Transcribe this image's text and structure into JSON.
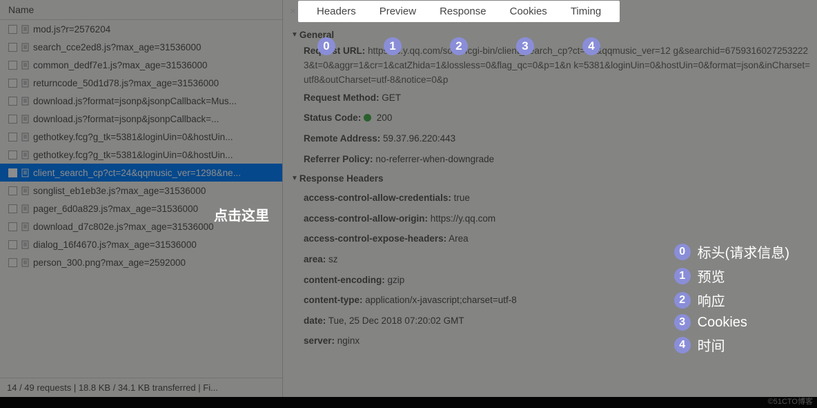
{
  "columns": {
    "name": "Name"
  },
  "requests": [
    {
      "name": "mod.js?r=2576204",
      "selected": false
    },
    {
      "name": "search_cce2ed8.js?max_age=31536000",
      "selected": false
    },
    {
      "name": "common_dedf7e1.js?max_age=31536000",
      "selected": false
    },
    {
      "name": "returncode_50d1d78.js?max_age=31536000",
      "selected": false
    },
    {
      "name": "download.js?format=jsonp&jsonpCallback=Mus...",
      "selected": false
    },
    {
      "name": "download.js?format=jsonp&jsonpCallback=...",
      "selected": false
    },
    {
      "name": "gethotkey.fcg?g_tk=5381&loginUin=0&hostUin...",
      "selected": false
    },
    {
      "name": "gethotkey.fcg?g_tk=5381&loginUin=0&hostUin...",
      "selected": false
    },
    {
      "name": "client_search_cp?ct=24&qqmusic_ver=1298&ne...",
      "selected": true
    },
    {
      "name": "songlist_eb1eb3e.js?max_age=31536000",
      "selected": false
    },
    {
      "name": "pager_6d0a829.js?max_age=31536000",
      "selected": false
    },
    {
      "name": "download_d7c802e.js?max_age=31536000",
      "selected": false
    },
    {
      "name": "dialog_16f4670.js?max_age=31536000",
      "selected": false
    },
    {
      "name": "person_300.png?max_age=2592000",
      "selected": false
    }
  ],
  "status_bar": "14 / 49 requests  |  18.8 KB / 34.1 KB transferred  |  Fi...",
  "tabs": [
    "Headers",
    "Preview",
    "Response",
    "Cookies",
    "Timing"
  ],
  "sections": {
    "general": {
      "title": "General",
      "request_url_label": "Request URL:",
      "request_url_value": "https://c.y.qq.com/soso/fcgi-bin/client_search_cp?ct=24&qqmusic_ver=12 g&searchid=67593160272532223&t=0&aggr=1&cr=1&catZhida=1&lossless=0&flag_qc=0&p=1&n k=5381&loginUin=0&hostUin=0&format=json&inCharset=utf8&outCharset=utf-8&notice=0&p",
      "request_method_label": "Request Method:",
      "request_method_value": "GET",
      "status_code_label": "Status Code:",
      "status_code_value": "200",
      "remote_address_label": "Remote Address:",
      "remote_address_value": "59.37.96.220:443",
      "referrer_policy_label": "Referrer Policy:",
      "referrer_policy_value": "no-referrer-when-downgrade"
    },
    "response_headers": {
      "title": "Response Headers",
      "items": [
        {
          "k": "access-control-allow-credentials:",
          "v": "true"
        },
        {
          "k": "access-control-allow-origin:",
          "v": "https://y.qq.com"
        },
        {
          "k": "access-control-expose-headers:",
          "v": "Area"
        },
        {
          "k": "area:",
          "v": "sz"
        },
        {
          "k": "content-encoding:",
          "v": "gzip"
        },
        {
          "k": "content-type:",
          "v": "application/x-javascript;charset=utf-8"
        },
        {
          "k": "date:",
          "v": "Tue, 25 Dec 2018 07:20:02 GMT"
        },
        {
          "k": "server:",
          "v": "nginx"
        }
      ]
    }
  },
  "annotation": {
    "nums": [
      "0",
      "1",
      "2",
      "3",
      "4"
    ],
    "click_hint": "点击这里",
    "legend": [
      {
        "n": "0",
        "t": "标头(请求信息)"
      },
      {
        "n": "1",
        "t": "预览"
      },
      {
        "n": "2",
        "t": "响应"
      },
      {
        "n": "3",
        "t": "Cookies"
      },
      {
        "n": "4",
        "t": "时间"
      }
    ]
  },
  "watermark": "©51CTO博客"
}
